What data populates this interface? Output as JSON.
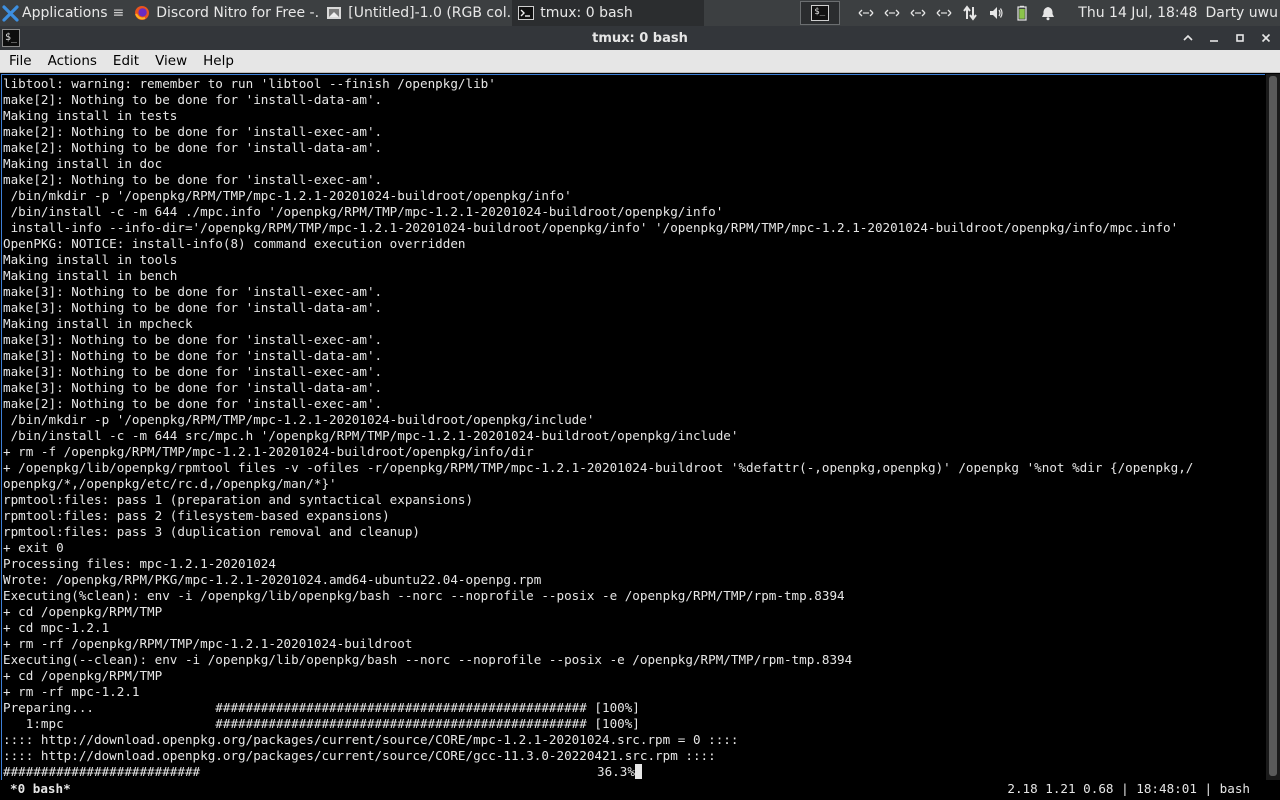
{
  "panel": {
    "applications_label": "Applications",
    "tasks": [
      {
        "label": "Discord Nitro for Free -...",
        "icon": "firefox-icon"
      },
      {
        "label": "[Untitled]-1.0 (RGB col...",
        "icon": "gimp-icon"
      },
      {
        "label": "tmux: 0 bash",
        "icon": "terminal-icon"
      }
    ],
    "clock": "Thu 14 Jul, 18:48",
    "user": "Darty uwu"
  },
  "window": {
    "title": "tmux: 0 bash"
  },
  "menubar": {
    "items": [
      "File",
      "Actions",
      "Edit",
      "View",
      "Help"
    ]
  },
  "terminal": {
    "lines": [
      "libtool: warning: remember to run 'libtool --finish /openpkg/lib'",
      "make[2]: Nothing to be done for 'install-data-am'.",
      "Making install in tests",
      "make[2]: Nothing to be done for 'install-exec-am'.",
      "make[2]: Nothing to be done for 'install-data-am'.",
      "Making install in doc",
      "make[2]: Nothing to be done for 'install-exec-am'.",
      " /bin/mkdir -p '/openpkg/RPM/TMP/mpc-1.2.1-20201024-buildroot/openpkg/info'",
      " /bin/install -c -m 644 ./mpc.info '/openpkg/RPM/TMP/mpc-1.2.1-20201024-buildroot/openpkg/info'",
      " install-info --info-dir='/openpkg/RPM/TMP/mpc-1.2.1-20201024-buildroot/openpkg/info' '/openpkg/RPM/TMP/mpc-1.2.1-20201024-buildroot/openpkg/info/mpc.info'",
      "OpenPKG: NOTICE: install-info(8) command execution overridden",
      "Making install in tools",
      "Making install in bench",
      "make[3]: Nothing to be done for 'install-exec-am'.",
      "make[3]: Nothing to be done for 'install-data-am'.",
      "Making install in mpcheck",
      "make[3]: Nothing to be done for 'install-exec-am'.",
      "make[3]: Nothing to be done for 'install-data-am'.",
      "make[3]: Nothing to be done for 'install-exec-am'.",
      "make[3]: Nothing to be done for 'install-data-am'.",
      "make[2]: Nothing to be done for 'install-exec-am'.",
      " /bin/mkdir -p '/openpkg/RPM/TMP/mpc-1.2.1-20201024-buildroot/openpkg/include'",
      " /bin/install -c -m 644 src/mpc.h '/openpkg/RPM/TMP/mpc-1.2.1-20201024-buildroot/openpkg/include'",
      "+ rm -f /openpkg/RPM/TMP/mpc-1.2.1-20201024-buildroot/openpkg/info/dir",
      "+ /openpkg/lib/openpkg/rpmtool files -v -ofiles -r/openpkg/RPM/TMP/mpc-1.2.1-20201024-buildroot '%defattr(-,openpkg,openpkg)' /openpkg '%not %dir {/openpkg,/",
      "openpkg/*,/openpkg/etc/rc.d,/openpkg/man/*}'",
      "rpmtool:files: pass 1 (preparation and syntactical expansions)",
      "rpmtool:files: pass 2 (filesystem-based expansions)",
      "rpmtool:files: pass 3 (duplication removal and cleanup)",
      "+ exit 0",
      "Processing files: mpc-1.2.1-20201024",
      "Wrote: /openpkg/RPM/PKG/mpc-1.2.1-20201024.amd64-ubuntu22.04-openpg.rpm",
      "Executing(%clean): env -i /openpkg/lib/openpkg/bash --norc --noprofile --posix -e /openpkg/RPM/TMP/rpm-tmp.8394",
      "+ cd /openpkg/RPM/TMP",
      "+ cd mpc-1.2.1",
      "+ rm -rf /openpkg/RPM/TMP/mpc-1.2.1-20201024-buildroot",
      "Executing(--clean): env -i /openpkg/lib/openpkg/bash --norc --noprofile --posix -e /openpkg/RPM/TMP/rpm-tmp.8394",
      "+ cd /openpkg/RPM/TMP",
      "+ rm -rf mpc-1.2.1",
      "Preparing...                ################################################# [100%]",
      "   1:mpc                    ################################################# [100%]",
      ":::: http://download.openpkg.org/packages/current/source/CORE/mpc-1.2.1-20201024.src.rpm = 0 ::::",
      ":::: http://download.openpkg.org/packages/current/source/CORE/gcc-11.3.0-20220421.src.rpm ::::"
    ],
    "progress_bar": "##########################",
    "progress_percent": "36.3%"
  },
  "tmux": {
    "window_label": "*0 bash*",
    "status_right": "2.18 1.21 0.68 | 18:48:01 | bash"
  }
}
